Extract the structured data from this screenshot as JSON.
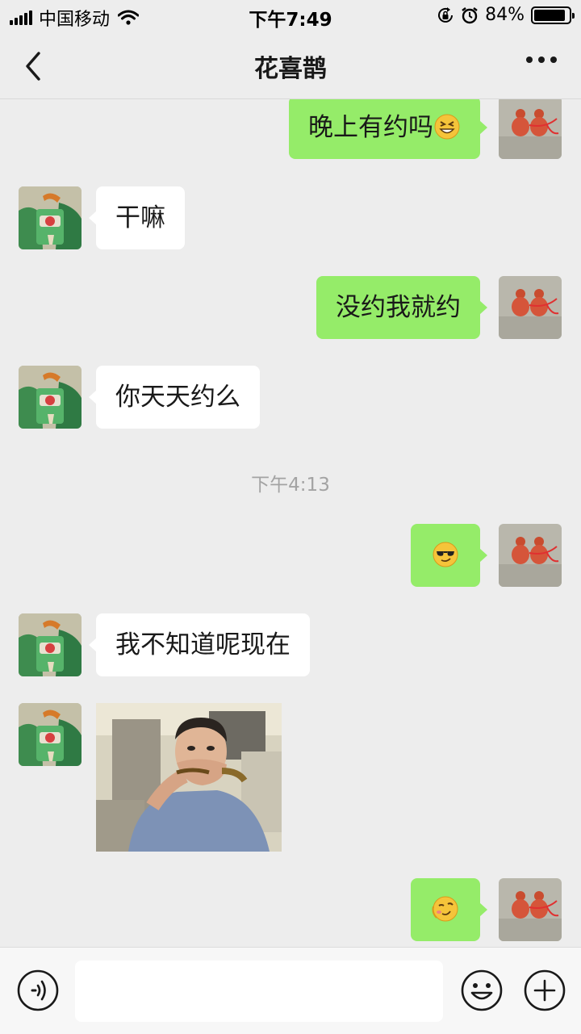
{
  "status_bar": {
    "carrier": "中国移动",
    "time": "下午7:49",
    "battery": "84%",
    "battery_level": 0.84,
    "icons": [
      "signal-icon",
      "wifi-icon",
      "rotation-lock-icon",
      "alarm-icon",
      "battery-icon"
    ]
  },
  "header": {
    "title": "花喜鹊",
    "back_icon": "chevron-left-icon",
    "more_icon": "more-dots-icon"
  },
  "messages": [
    {
      "side": "out",
      "text": "晚上有约吗",
      "emoji": "grinning-squint-emoji"
    },
    {
      "side": "in",
      "text": "干嘛"
    },
    {
      "side": "out",
      "text": "没约我就约"
    },
    {
      "side": "in",
      "text": "你天天约么"
    },
    {
      "timestamp": "下午4:13"
    },
    {
      "side": "out",
      "emoji": "cool-sunglasses-emoji"
    },
    {
      "side": "in",
      "text": "我不知道呢现在"
    },
    {
      "side": "in",
      "sticker": "man-covering-mouth-sticker"
    },
    {
      "side": "out",
      "emoji": "smirk-emoji"
    }
  ],
  "input_bar": {
    "placeholder": "",
    "icons": [
      "voice-icon",
      "emoji-icon",
      "plus-icon"
    ]
  },
  "colors": {
    "background": "#ededed",
    "outgoing_bubble": "#95ec69",
    "incoming_bubble": "#ffffff",
    "timestamp": "#a3a3a3"
  }
}
